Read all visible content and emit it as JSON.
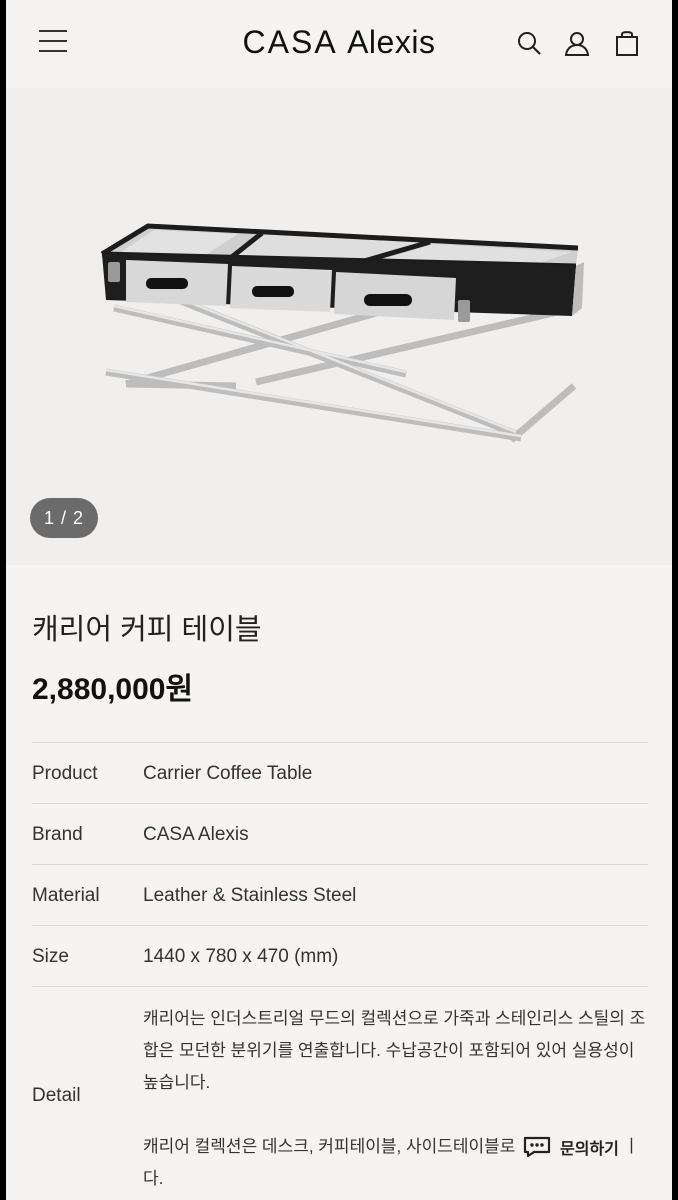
{
  "header": {
    "logo_part1": "CASA",
    "logo_part2": "Alexis",
    "icons": [
      "menu-icon",
      "search-icon",
      "account-icon",
      "shopping-bag-icon"
    ]
  },
  "gallery": {
    "counter": "1 / 2"
  },
  "product": {
    "title": "캐리어 커피 테이블",
    "price": "2,880,000원"
  },
  "specs": [
    {
      "label": "Product",
      "value": "Carrier Coffee Table"
    },
    {
      "label": "Brand",
      "value": "CASA Alexis"
    },
    {
      "label": "Material",
      "value": "Leather & Stainless Steel"
    },
    {
      "label": "Size",
      "value": "1440 x 780 x 470 (mm)"
    }
  ],
  "detail": {
    "label": "Detail",
    "paragraph1": "캐리어는 인더스트리얼 무드의 컬렉션으로 가죽과 스테인리스 스틸의 조합은 모던한 분위기를 연출합니다. 수납공간이 포함되어 있어 실용성이 높습니다.",
    "paragraph2": "캐리어 컬렉션은 데스크, 커피테이블, 사이드테이블로 구성되어 있습니다."
  },
  "inquiry": {
    "label": "문의하기"
  }
}
